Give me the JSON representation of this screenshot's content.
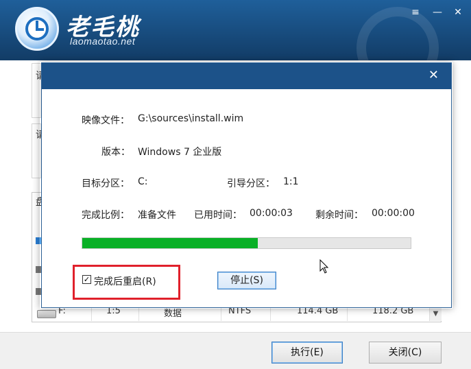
{
  "header": {
    "brand_title": "老毛桃",
    "brand_subtitle": "laomaotao.net",
    "menu_icon": "menu-icon",
    "minimize_icon": "minimize-icon",
    "close_icon": "close-icon",
    "colors": {
      "bg": "#174a7b",
      "text": "#ffffff"
    }
  },
  "background": {
    "side_labels": [
      "请",
      "请",
      "盘"
    ],
    "disk_row": {
      "drive": "F:",
      "index": "1:5",
      "type": "数据",
      "fs": "NTFS",
      "capacity": "114.4 GB",
      "free": "118.2 GB"
    }
  },
  "footer": {
    "execute_label": "执行(E)",
    "close_label": "关闭(C)"
  },
  "dialog": {
    "image_file_label": "映像文件：",
    "image_file_value": "G:\\sources\\install.wim",
    "version_label": "版本：",
    "version_value": "Windows 7 企业版",
    "target_label": "目标分区：",
    "target_value": "C:",
    "boot_label": "引导分区：",
    "boot_value": "1:1",
    "ratio_label": "完成比例：",
    "ratio_value": "准备文件",
    "elapsed_label": "已用时间：",
    "elapsed_value": "00:00:03",
    "remaining_label": "剩余时间：",
    "remaining_value": "00:00:00",
    "progress_fraction": 0.535,
    "progress_color": "#09b026",
    "reboot_checkbox_label": "完成后重启(R)",
    "reboot_checked": true,
    "checkmark": "✓",
    "stop_label": "停止(S)",
    "close_glyph": "✕",
    "highlight_color": "#e0202b"
  }
}
